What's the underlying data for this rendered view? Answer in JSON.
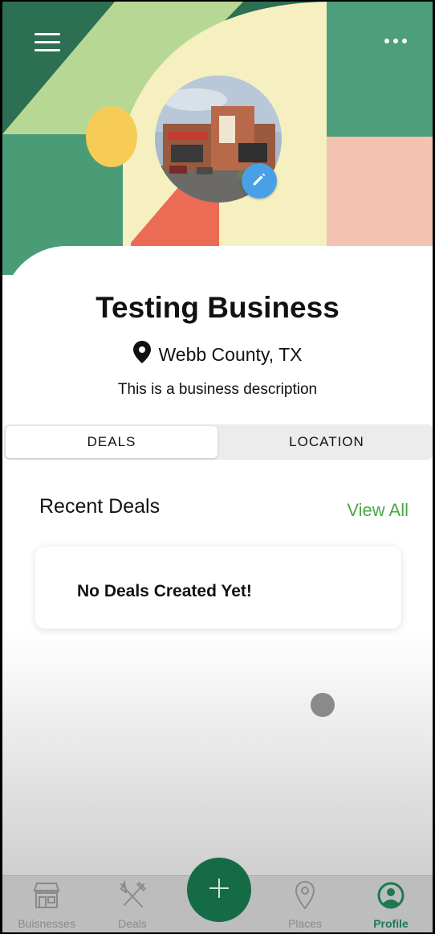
{
  "header": {
    "menu_icon": "hamburger-menu-icon",
    "more_icon": "more-horizontal-icon"
  },
  "profile": {
    "name": "Testing Business",
    "location": "Webb County, TX",
    "description": "This is a business description",
    "edit_icon": "pencil-icon"
  },
  "tabs": [
    {
      "label": "DEALS",
      "active": true
    },
    {
      "label": "LOCATION",
      "active": false
    }
  ],
  "recent_deals": {
    "heading": "Recent Deals",
    "view_all": "View All",
    "empty_text": "No Deals Created Yet!"
  },
  "bottom_nav": {
    "items": [
      {
        "label": "Buisnesses",
        "icon": "storefront-icon"
      },
      {
        "label": "Deals",
        "icon": "fork-knife-icon"
      },
      {
        "label": "Places",
        "icon": "map-pin-icon"
      },
      {
        "label": "Profile",
        "icon": "user-circle-icon",
        "active": true
      }
    ],
    "fab_icon": "plus-icon"
  },
  "colors": {
    "accent_green": "#4aa845",
    "brand_dark_green": "#166b47",
    "edit_blue": "#4aa0e6"
  }
}
